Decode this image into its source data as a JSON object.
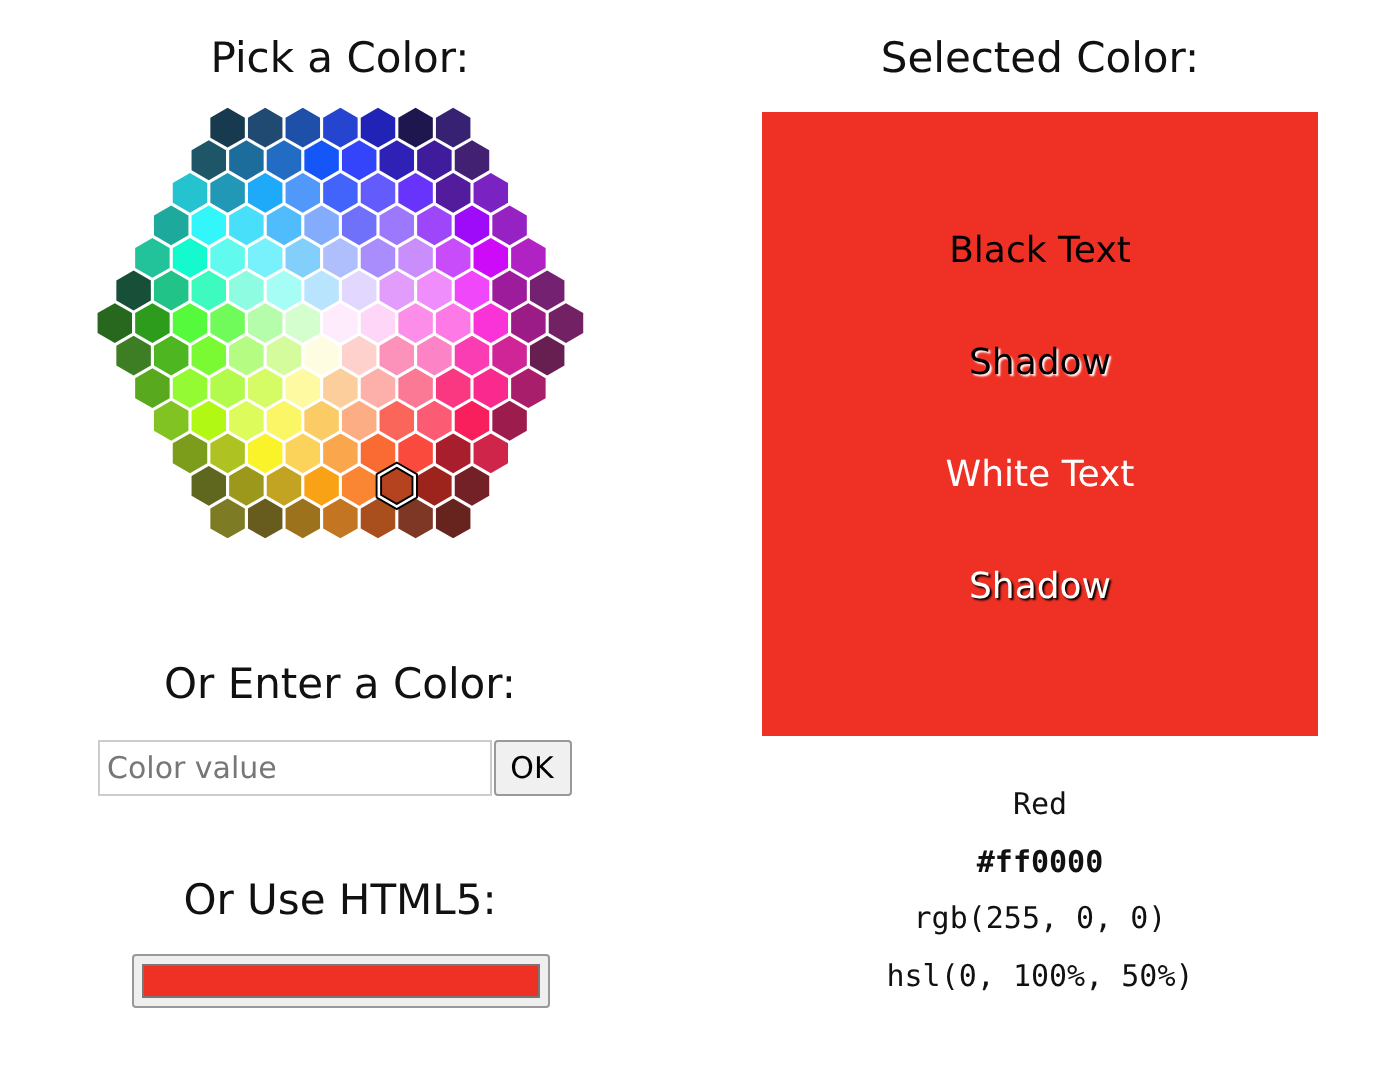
{
  "picker": {
    "title": "Pick a Color:",
    "color_map": {
      "rows": [
        [
          {
            "selected": false
          },
          {
            "selected": false
          },
          {
            "selected": false
          },
          {
            "selected": false
          },
          {
            "selected": false
          },
          {
            "selected": false
          },
          {
            "selected": false
          }
        ],
        [
          {
            "selected": false
          },
          {
            "selected": false
          },
          {
            "selected": false
          },
          {
            "selected": false
          },
          {
            "selected": false
          },
          {
            "selected": false
          },
          {
            "selected": false
          },
          {
            "selected": false
          }
        ],
        [
          {
            "selected": false
          },
          {
            "selected": false
          },
          {
            "selected": false
          },
          {
            "selected": false
          },
          {
            "selected": false
          },
          {
            "selected": false
          },
          {
            "selected": false
          },
          {
            "selected": false
          },
          {
            "selected": false
          }
        ],
        [
          {
            "selected": false
          },
          {
            "selected": false
          },
          {
            "selected": false
          },
          {
            "selected": false
          },
          {
            "selected": false
          },
          {
            "selected": false
          },
          {
            "selected": false
          },
          {
            "selected": false
          },
          {
            "selected": false
          },
          {
            "selected": false
          }
        ],
        [
          {
            "selected": false
          },
          {
            "selected": false
          },
          {
            "selected": false
          },
          {
            "selected": false
          },
          {
            "selected": false
          },
          {
            "selected": false
          },
          {
            "selected": false
          },
          {
            "selected": false
          },
          {
            "selected": false
          },
          {
            "selected": false
          },
          {
            "selected": false
          }
        ],
        [
          {
            "selected": false
          },
          {
            "selected": false
          },
          {
            "selected": false
          },
          {
            "selected": false
          },
          {
            "selected": false
          },
          {
            "selected": false
          },
          {
            "selected": false
          },
          {
            "selected": false
          },
          {
            "selected": false
          },
          {
            "selected": false
          },
          {
            "selected": false
          },
          {
            "selected": false
          }
        ],
        [
          {
            "selected": false
          },
          {
            "selected": false
          },
          {
            "selected": false
          },
          {
            "selected": false
          },
          {
            "selected": false
          },
          {
            "selected": false
          },
          {
            "selected": false
          },
          {
            "selected": false
          },
          {
            "selected": false
          },
          {
            "selected": false
          },
          {
            "selected": false
          },
          {
            "selected": false
          },
          {
            "selected": false
          }
        ],
        [
          {
            "selected": false
          },
          {
            "selected": false
          },
          {
            "selected": false
          },
          {
            "selected": false
          },
          {
            "selected": false
          },
          {
            "selected": false
          },
          {
            "selected": false
          },
          {
            "selected": false
          },
          {
            "selected": false
          },
          {
            "selected": false
          },
          {
            "selected": false
          },
          {
            "selected": false
          }
        ],
        [
          {
            "selected": false
          },
          {
            "selected": false
          },
          {
            "selected": false
          },
          {
            "selected": false
          },
          {
            "selected": false
          },
          {
            "selected": false
          },
          {
            "selected": false
          },
          {
            "selected": false
          },
          {
            "selected": false
          },
          {
            "selected": false
          },
          {
            "selected": false
          }
        ],
        [
          {
            "selected": false
          },
          {
            "selected": false
          },
          {
            "selected": false
          },
          {
            "selected": false
          },
          {
            "selected": false
          },
          {
            "selected": false
          },
          {
            "selected": false
          },
          {
            "selected": false
          },
          {
            "selected": false
          },
          {
            "selected": false
          }
        ],
        [
          {
            "selected": false
          },
          {
            "selected": false
          },
          {
            "selected": false
          },
          {
            "selected": false
          },
          {
            "selected": false
          },
          {
            "selected": false
          },
          {
            "selected": false
          },
          {
            "selected": false
          },
          {
            "selected": false
          }
        ],
        [
          {
            "selected": false
          },
          {
            "selected": false
          },
          {
            "selected": false
          },
          {
            "selected": false
          },
          {
            "selected": false
          },
          {
            "selected": true
          },
          {
            "selected": false
          },
          {
            "selected": false
          }
        ],
        [
          {
            "selected": false
          },
          {
            "selected": false
          },
          {
            "selected": false
          },
          {
            "selected": false
          },
          {
            "selected": false
          },
          {
            "selected": false
          },
          {
            "selected": false
          }
        ]
      ]
    }
  },
  "enter": {
    "title": "Or Enter a Color:",
    "placeholder": "Color value",
    "button": "OK"
  },
  "html5": {
    "title": "Or Use HTML5:",
    "color": "#ee3124"
  },
  "selected": {
    "title": "Selected Color:",
    "color": "#ee3124",
    "samples": [
      {
        "text": "Black Text",
        "kind": "black",
        "shadow": false
      },
      {
        "text": "Shadow",
        "kind": "black",
        "shadow": true
      },
      {
        "text": "White Text",
        "kind": "white",
        "shadow": false
      },
      {
        "text": "Shadow",
        "kind": "white",
        "shadow": true
      }
    ],
    "info": [
      {
        "text": "Red",
        "bold": false
      },
      {
        "text": "#ff0000",
        "bold": true
      },
      {
        "text": "rgb(255, 0, 0)",
        "bold": false
      },
      {
        "text": "hsl(0, 100%, 50%)",
        "bold": false
      }
    ]
  }
}
